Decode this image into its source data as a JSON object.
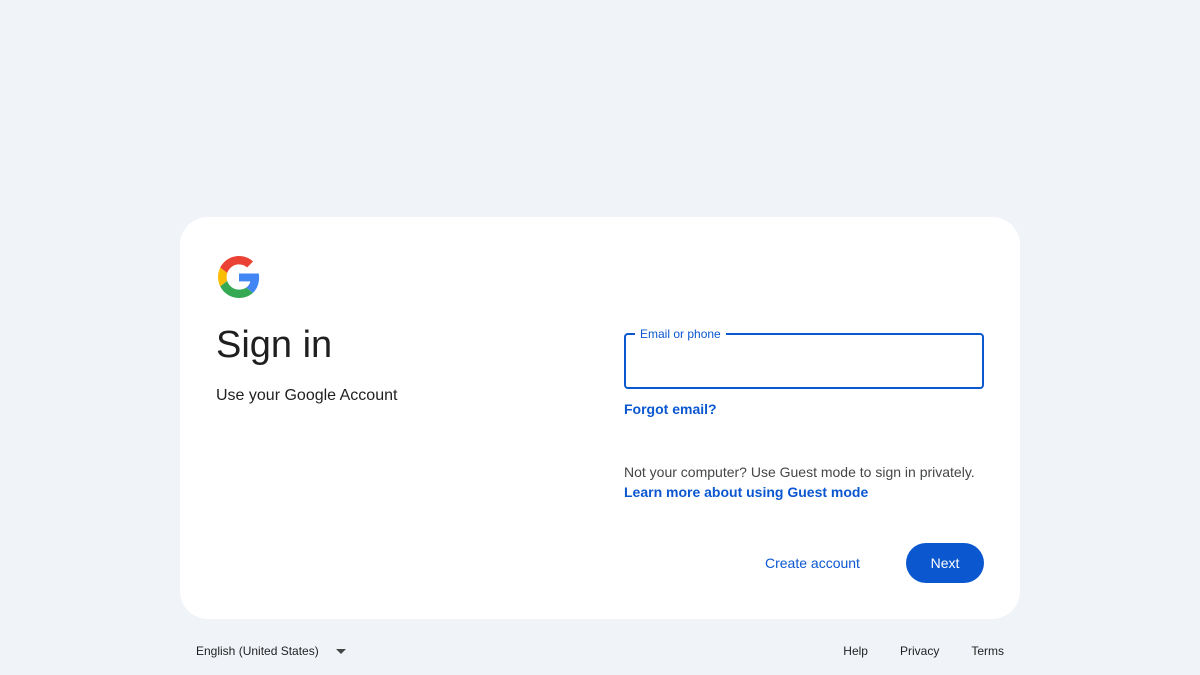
{
  "card": {
    "title": "Sign in",
    "subtitle": "Use your Google Account",
    "email_field": {
      "label": "Email or phone",
      "value": "",
      "placeholder": ""
    },
    "forgot_email": "Forgot email?",
    "guest_text": "Not your computer? Use Guest mode to sign in privately.",
    "guest_link": "Learn more about using Guest mode",
    "create_account": "Create account",
    "next": "Next"
  },
  "footer": {
    "language": "English (United States)",
    "links": [
      "Help",
      "Privacy",
      "Terms"
    ]
  },
  "icons": {
    "logo": "google-g-logo-icon",
    "dropdown": "caret-down-icon"
  },
  "colors": {
    "accent": "#0b57d0",
    "background": "#f0f4f9",
    "card": "#ffffff",
    "google_blue": "#4285f4",
    "google_red": "#ea4335",
    "google_yellow": "#fbbc05",
    "google_green": "#34a853"
  }
}
